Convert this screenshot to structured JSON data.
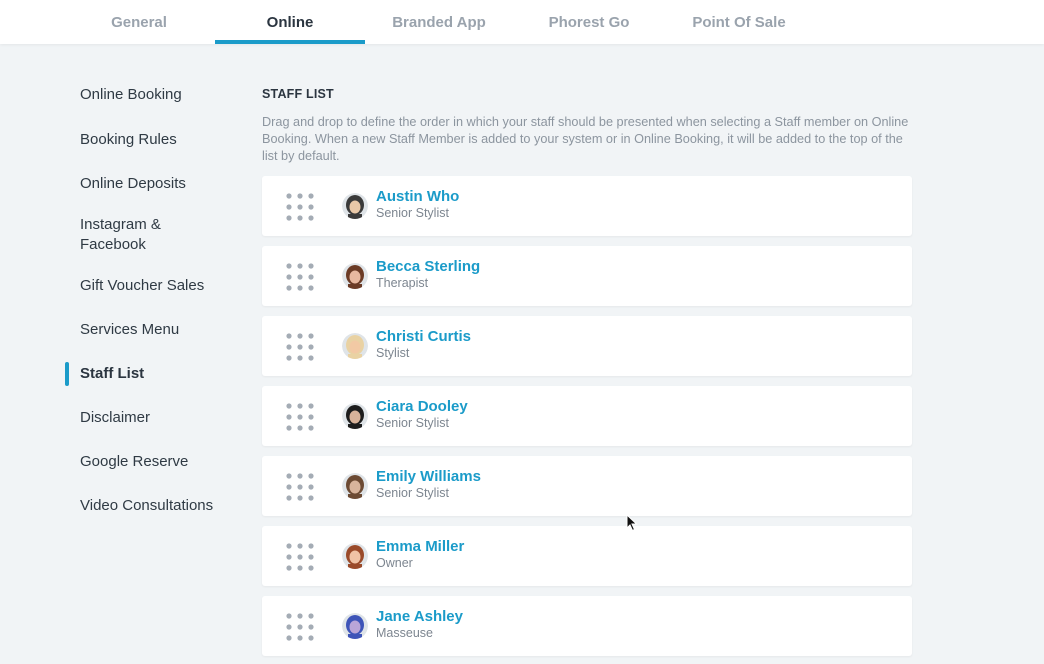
{
  "tabs": [
    {
      "label": "General",
      "active": false
    },
    {
      "label": "Online",
      "active": true
    },
    {
      "label": "Branded App",
      "active": false
    },
    {
      "label": "Phorest Go",
      "active": false
    },
    {
      "label": "Point Of Sale",
      "active": false
    }
  ],
  "sidebar": {
    "items": [
      {
        "label": "Online Booking"
      },
      {
        "label": "Booking Rules"
      },
      {
        "label": "Online Deposits"
      },
      {
        "label": "Instagram & Facebook"
      },
      {
        "label": "Gift Voucher Sales"
      },
      {
        "label": "Services Menu"
      },
      {
        "label": "Staff List",
        "active": true
      },
      {
        "label": "Disclaimer"
      },
      {
        "label": "Google Reserve"
      },
      {
        "label": "Video Consultations"
      }
    ]
  },
  "main": {
    "section_title": "STAFF LIST",
    "section_description": "Drag and drop to define the order in which your staff should be presented when selecting a Staff member on Online Booking. When a new Staff Member is added to your system or in Online Booking, it will be added to the top of the list by default.",
    "staff": [
      {
        "name": "Austin Who",
        "role": "Senior Stylist"
      },
      {
        "name": "Becca Sterling",
        "role": "Therapist"
      },
      {
        "name": "Christi Curtis",
        "role": "Stylist"
      },
      {
        "name": "Ciara Dooley",
        "role": "Senior Stylist"
      },
      {
        "name": "Emily Williams",
        "role": "Senior Stylist"
      },
      {
        "name": "Emma Miller",
        "role": "Owner"
      },
      {
        "name": "Jane Ashley",
        "role": "Masseuse"
      }
    ]
  },
  "colors": {
    "accent": "#1b9bc9",
    "background": "#f1f4f6",
    "card": "#ffffff",
    "muted_text": "#8c959f"
  },
  "icons": {
    "drag_handle": "drag-handle-icon",
    "avatar": "avatar-photo",
    "cursor": "mouse-pointer-icon"
  }
}
